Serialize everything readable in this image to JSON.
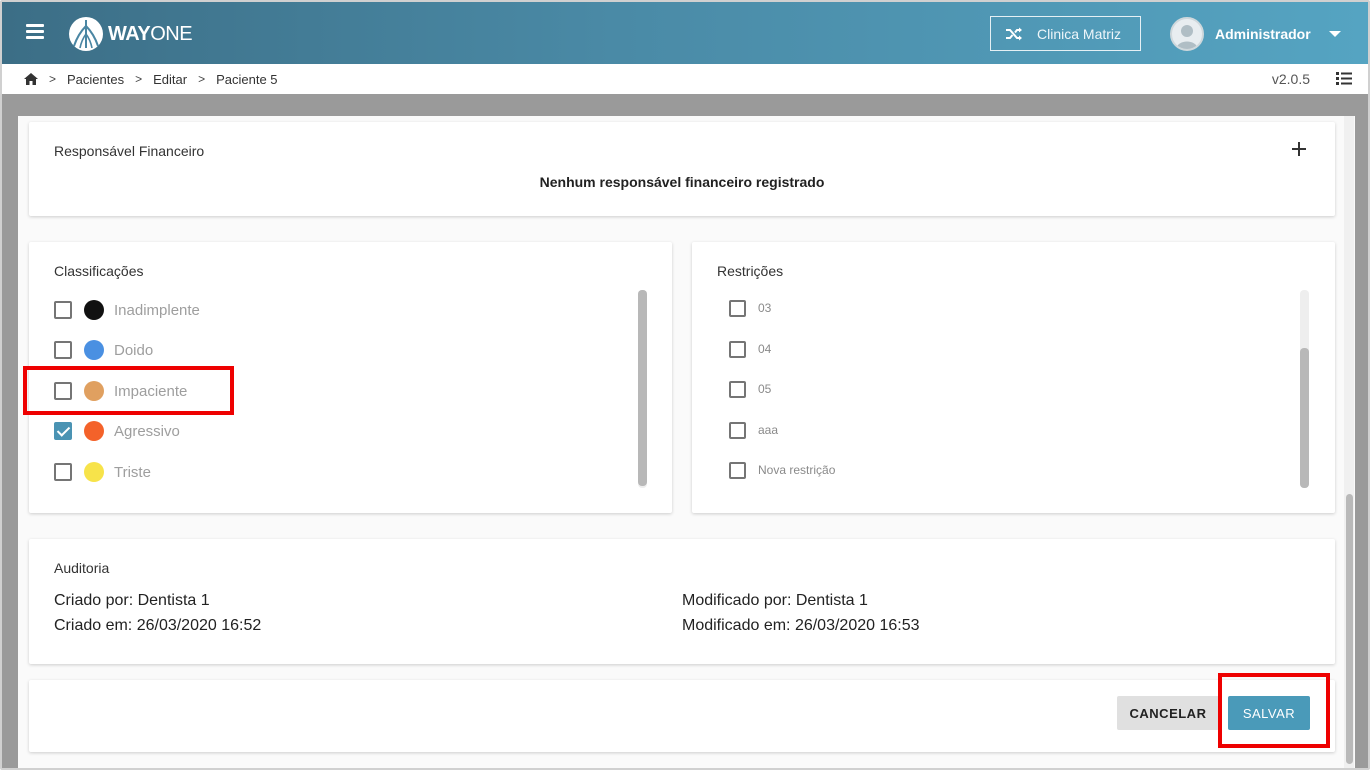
{
  "header": {
    "brand_bold": "WAY",
    "brand_light": "ONE",
    "clinic_label": "Clinica Matriz",
    "user_name": "Administrador"
  },
  "breadcrumb": {
    "items": [
      "Pacientes",
      "Editar",
      "Paciente 5"
    ],
    "version": "v2.0.5"
  },
  "financeiro": {
    "title": "Responsável Financeiro",
    "empty_message": "Nenhum responsável financeiro registrado"
  },
  "classificacoes": {
    "title": "Classificações",
    "items": [
      {
        "label": "Inadimplente",
        "color": "#111111",
        "checked": false
      },
      {
        "label": "Doido",
        "color": "#4a90e2",
        "checked": false
      },
      {
        "label": "Impaciente",
        "color": "#e0a060",
        "checked": false
      },
      {
        "label": "Agressivo",
        "color": "#f4622a",
        "checked": true
      },
      {
        "label": "Triste",
        "color": "#f7e34a",
        "checked": false
      }
    ]
  },
  "restricoes": {
    "title": "Restrições",
    "items": [
      {
        "label": "03",
        "checked": false
      },
      {
        "label": "04",
        "checked": false
      },
      {
        "label": "05",
        "checked": false
      },
      {
        "label": "aaa",
        "checked": false
      },
      {
        "label": "Nova restrição",
        "checked": false
      }
    ]
  },
  "auditoria": {
    "title": "Auditoria",
    "criado_por": "Criado por: Dentista 1",
    "criado_em": "Criado em: 26/03/2020 16:52",
    "modificado_por": "Modificado por: Dentista 1",
    "modificado_em": "Modificado em: 26/03/2020 16:53"
  },
  "actions": {
    "cancel_label": "CANCELAR",
    "save_label": "SALVAR"
  },
  "colors": {
    "accent": "#4a9ab9",
    "highlight": "#ee0000"
  }
}
